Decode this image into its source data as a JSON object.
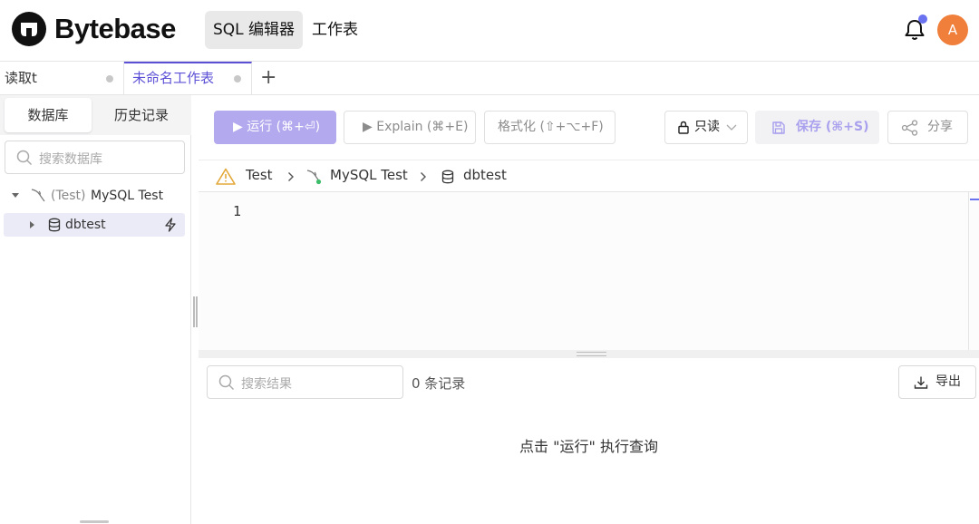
{
  "header": {
    "brand": "Bytebase",
    "nav": [
      "SQL 编辑器",
      "工作表"
    ],
    "avatar_initial": "A",
    "notification_dot_color": "#6b72f0",
    "avatar_color": "#ef7f3b"
  },
  "tabs": [
    {
      "label": "读取t",
      "active": false
    },
    {
      "label": "未命名工作表",
      "active": true
    }
  ],
  "tab_add_label": "+",
  "sidebar": {
    "tabs": [
      "数据库",
      "历史记录"
    ],
    "search_placeholder": "搜索数据库",
    "tree": {
      "instance_env": "(Test)",
      "instance_name": "MySQL Test",
      "database": "dbtest"
    }
  },
  "toolbar": {
    "run": "▶ 运行 (⌘+⏎)",
    "explain": "▶ Explain (⌘+E)",
    "format": "格式化 (⇧+⌥+F)",
    "readonly": "只读",
    "save": "保存 (⌘+S)",
    "share": "分享"
  },
  "breadcrumb": {
    "environment": "Test",
    "instance": "MySQL Test",
    "database": "dbtest"
  },
  "editor": {
    "line_numbers": [
      "1"
    ]
  },
  "results": {
    "search_placeholder": "搜索结果",
    "count_text": "0 条记录",
    "export_label": "导出",
    "empty_message": "点击 \"运行\" 执行查询"
  },
  "colors": {
    "accent": "#5b50d6",
    "run_button": "#b3a9ee"
  }
}
